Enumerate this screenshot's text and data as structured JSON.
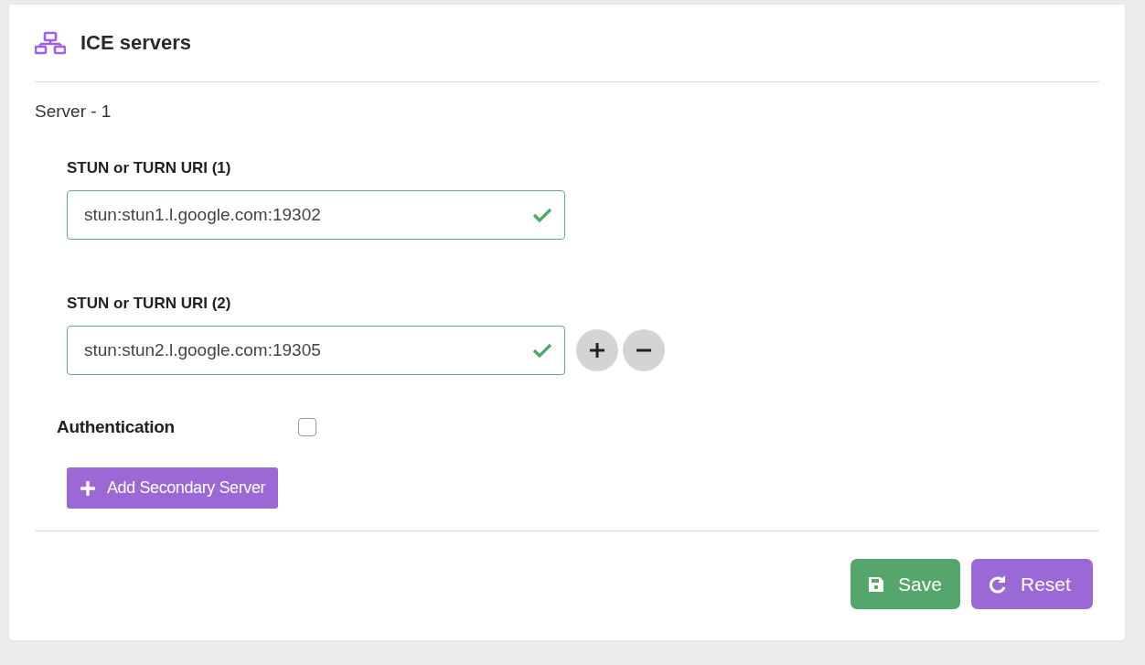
{
  "panel": {
    "title": "ICE servers"
  },
  "server": {
    "label": "Server - 1",
    "uris": [
      {
        "label": "STUN or TURN URI (1)",
        "value": "stun:stun1.l.google.com:19302",
        "valid": true,
        "show_controls": false
      },
      {
        "label": "STUN or TURN URI (2)",
        "value": "stun:stun2.l.google.com:19305",
        "valid": true,
        "show_controls": true
      }
    ],
    "authentication": {
      "label": "Authentication",
      "checked": false
    },
    "add_button": "Add Secondary Server"
  },
  "buttons": [
    {
      "kind": "save",
      "label": "Save"
    },
    {
      "kind": "reset",
      "label": "Reset"
    }
  ]
}
